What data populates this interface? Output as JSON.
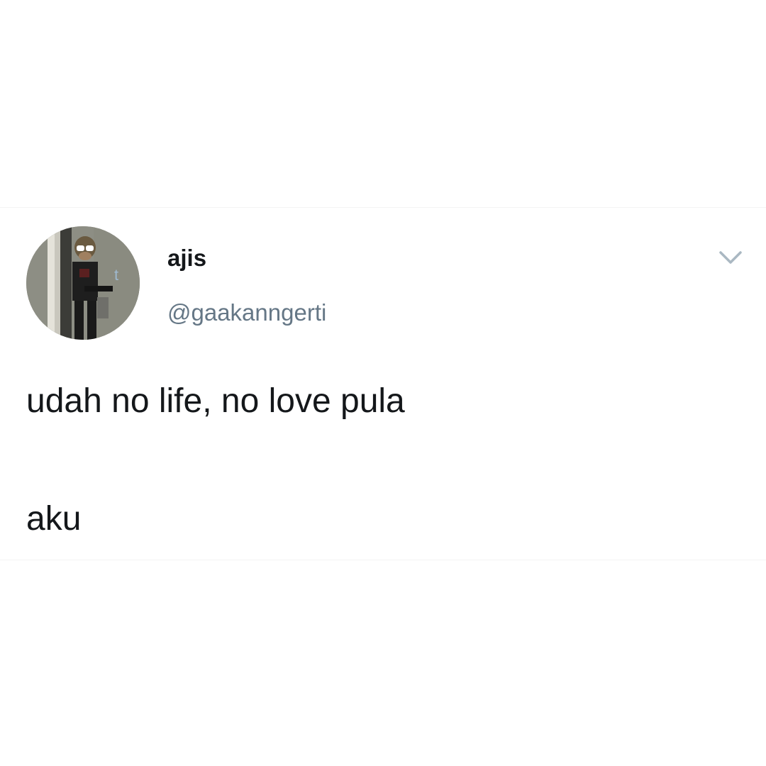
{
  "tweet": {
    "author": {
      "display_name": "ajis",
      "handle": "@gaakanngerti",
      "avatar_icon": "profile-photo"
    },
    "menu_icon": "chevron-down-icon",
    "text_lines": [
      "udah no life, no love pula",
      "aku"
    ]
  },
  "colors": {
    "name": "#14171a",
    "handle": "#657786",
    "caret": "#aab8c2",
    "background": "#ffffff"
  }
}
